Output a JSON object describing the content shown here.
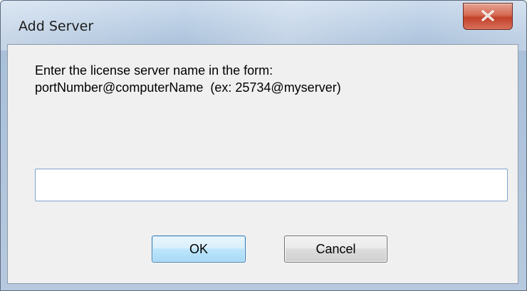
{
  "window": {
    "title": "Add Server"
  },
  "prompt": {
    "line1": "Enter the license server name in the form:",
    "line2": "portNumber@computerName  (ex: 25734@myserver)"
  },
  "server_input": {
    "value": "",
    "placeholder": ""
  },
  "buttons": {
    "ok_label": "OK",
    "cancel_label": "Cancel"
  },
  "icons": {
    "close": "close-icon"
  },
  "colors": {
    "close_button": "#c9523b",
    "ok_button_accent": "#3c7fb1",
    "dialog_background": "#f0f0f0"
  }
}
